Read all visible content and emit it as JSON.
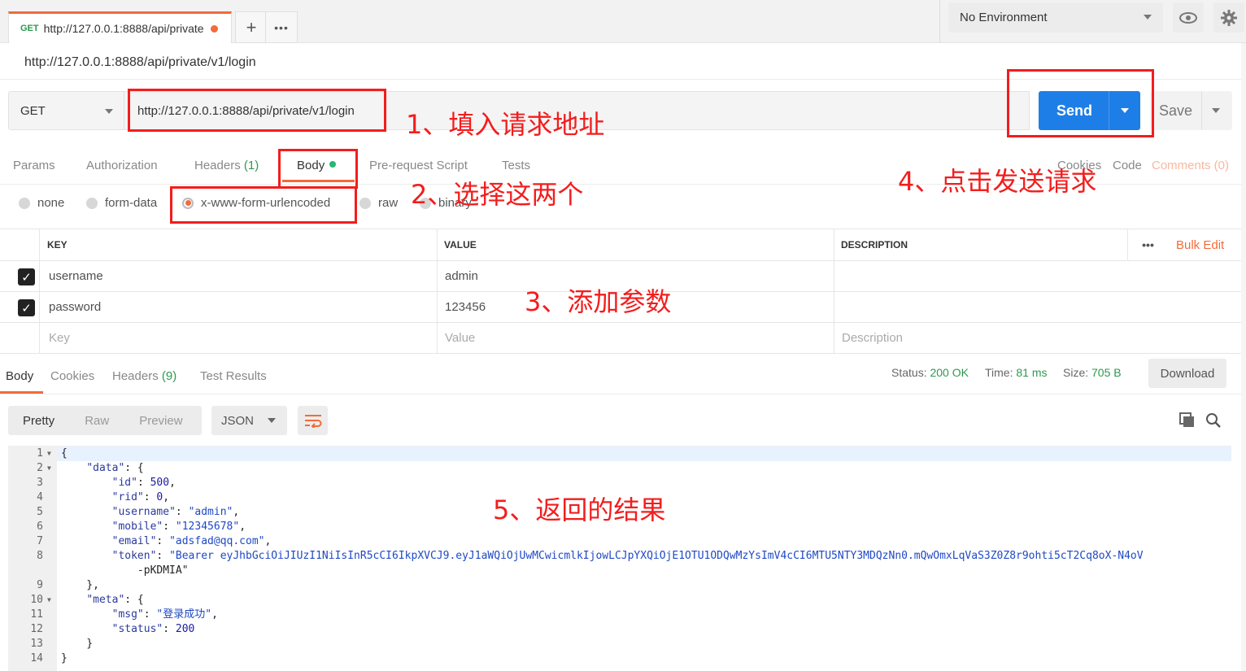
{
  "tab": {
    "method": "GET",
    "url": "http://127.0.0.1:8888/api/private"
  },
  "tab_actions": {
    "add": "+",
    "more": "•••"
  },
  "environment": "No Environment",
  "request_title": "http://127.0.0.1:8888/api/private/v1/login",
  "request": {
    "method": "GET",
    "url": "http://127.0.0.1:8888/api/private/v1/login",
    "send_label": "Send",
    "save_label": "Save"
  },
  "request_tabs": {
    "params": "Params",
    "authorization": "Authorization",
    "headers": "Headers",
    "headers_count": "(1)",
    "body": "Body",
    "prerequest": "Pre-request Script",
    "tests": "Tests",
    "cookies": "Cookies",
    "code": "Code",
    "comments": "Comments (0)"
  },
  "body_types": [
    "none",
    "form-data",
    "x-www-form-urlencoded",
    "raw",
    "binary"
  ],
  "kv_table": {
    "headers": {
      "key": "KEY",
      "value": "VALUE",
      "description": "DESCRIPTION",
      "more": "•••",
      "bulk_edit": "Bulk Edit"
    },
    "rows": [
      {
        "key": "username",
        "value": "admin",
        "description": ""
      },
      {
        "key": "password",
        "value": "123456",
        "description": ""
      }
    ],
    "placeholders": {
      "key": "Key",
      "value": "Value",
      "description": "Description"
    }
  },
  "response_tabs": {
    "body": "Body",
    "cookies": "Cookies",
    "headers": "Headers",
    "headers_count": "(9)",
    "test_results": "Test Results"
  },
  "response_status": {
    "status_label": "Status:",
    "status_value": "200 OK",
    "time_label": "Time:",
    "time_value": "81 ms",
    "size_label": "Size:",
    "size_value": "705 B",
    "download": "Download"
  },
  "format": {
    "pretty": "Pretty",
    "raw": "Raw",
    "preview": "Preview",
    "json": "JSON"
  },
  "code_lines": [
    {
      "n": "1",
      "fold": true,
      "t": "{"
    },
    {
      "n": "2",
      "fold": true,
      "t": "    \"data\": {"
    },
    {
      "n": "3",
      "fold": false,
      "t": "        \"id\": 500,"
    },
    {
      "n": "4",
      "fold": false,
      "t": "        \"rid\": 0,"
    },
    {
      "n": "5",
      "fold": false,
      "t": "        \"username\": \"admin\","
    },
    {
      "n": "6",
      "fold": false,
      "t": "        \"mobile\": \"12345678\","
    },
    {
      "n": "7",
      "fold": false,
      "t": "        \"email\": \"adsfad@qq.com\","
    },
    {
      "n": "8",
      "fold": false,
      "t": "        \"token\": \"Bearer eyJhbGciOiJIUzI1NiIsInR5cCI6IkpXVCJ9.eyJ1aWQiOjUwMCwicmlkIjowLCJpYXQiOjE1OTU1ODQwMzYsImV4cCI6MTU5NTY3MDQzNn0.mQwOmxLqVaS3Z0Z8r9ohti5cT2Cq8oX-N4oV"
    },
    {
      "n": "",
      "fold": false,
      "t": "            -pKDMIA\""
    },
    {
      "n": "9",
      "fold": false,
      "t": "    },"
    },
    {
      "n": "10",
      "fold": true,
      "t": "    \"meta\": {"
    },
    {
      "n": "11",
      "fold": false,
      "t": "        \"msg\": \"登录成功\","
    },
    {
      "n": "12",
      "fold": false,
      "t": "        \"status\": 200"
    },
    {
      "n": "13",
      "fold": false,
      "t": "    }"
    },
    {
      "n": "14",
      "fold": false,
      "t": "}"
    }
  ],
  "annotations": {
    "a1": "1、填入请求地址",
    "a2": "2、选择这两个",
    "a3": "3、添加参数",
    "a4": "4、点击发送请求",
    "a5": "5、返回的结果"
  },
  "colors": {
    "accent": "#f26b3a",
    "send": "#1e7ee8",
    "success": "#2c9a4d",
    "annotation": "#f31d1d"
  }
}
